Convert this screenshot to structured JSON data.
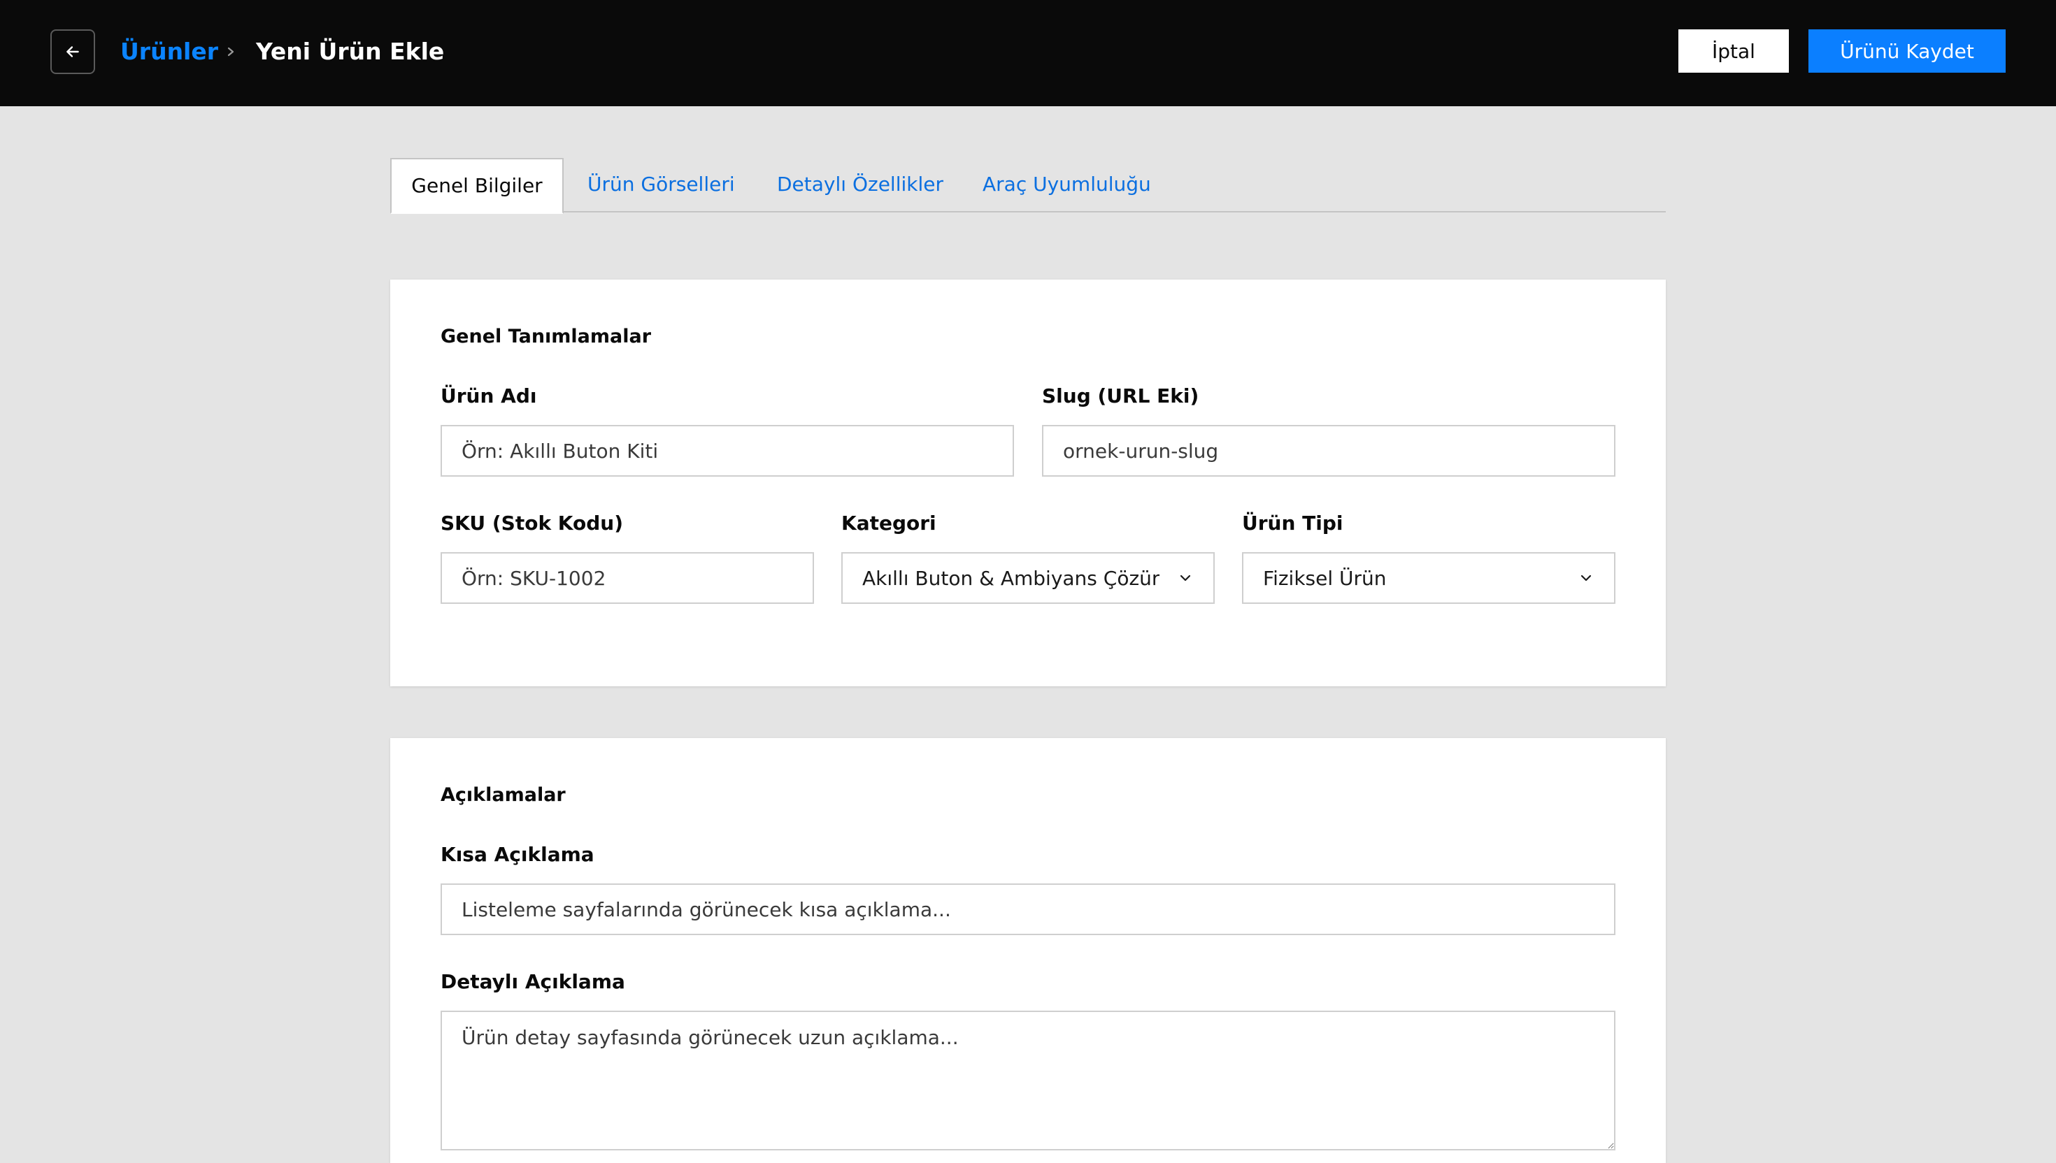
{
  "header": {
    "back_icon": "arrow-left-icon",
    "breadcrumb_parent": "Ürünler",
    "breadcrumb_separator_icon": "chevron-right-icon",
    "title": "Yeni Ürün Ekle",
    "cancel_label": "İptal",
    "save_label": "Ürünü Kaydet",
    "accent_color": "#0b7fff",
    "background_color": "#0a0a0a"
  },
  "tabs": [
    {
      "label": "Genel Bilgiler",
      "active": true
    },
    {
      "label": "Ürün Görselleri",
      "active": false
    },
    {
      "label": "Detaylı Özellikler",
      "active": false
    },
    {
      "label": "Araç Uyumluluğu",
      "active": false
    }
  ],
  "general": {
    "title": "Genel Tanımlamalar",
    "product_name": {
      "label": "Ürün Adı",
      "placeholder": "Örn: Akıllı Buton Kiti",
      "value": ""
    },
    "slug": {
      "label": "Slug (URL Eki)",
      "placeholder": "ornek-urun-slug",
      "value": ""
    },
    "sku": {
      "label": "SKU (Stok Kodu)",
      "placeholder": "Örn: SKU-1002",
      "value": ""
    },
    "category": {
      "label": "Kategori",
      "selected": "Akıllı Buton & Ambiyans Çözür",
      "icon": "chevron-down-icon"
    },
    "product_type": {
      "label": "Ürün Tipi",
      "selected": "Fiziksel Ürün",
      "icon": "chevron-down-icon"
    }
  },
  "descriptions": {
    "title": "Açıklamalar",
    "short": {
      "label": "Kısa Açıklama",
      "placeholder": "Listeleme sayfalarında görünecek kısa açıklama...",
      "value": ""
    },
    "detailed": {
      "label": "Detaylı Açıklama",
      "placeholder": "Ürün detay sayfasında görünecek uzun açıklama...",
      "value": ""
    }
  }
}
